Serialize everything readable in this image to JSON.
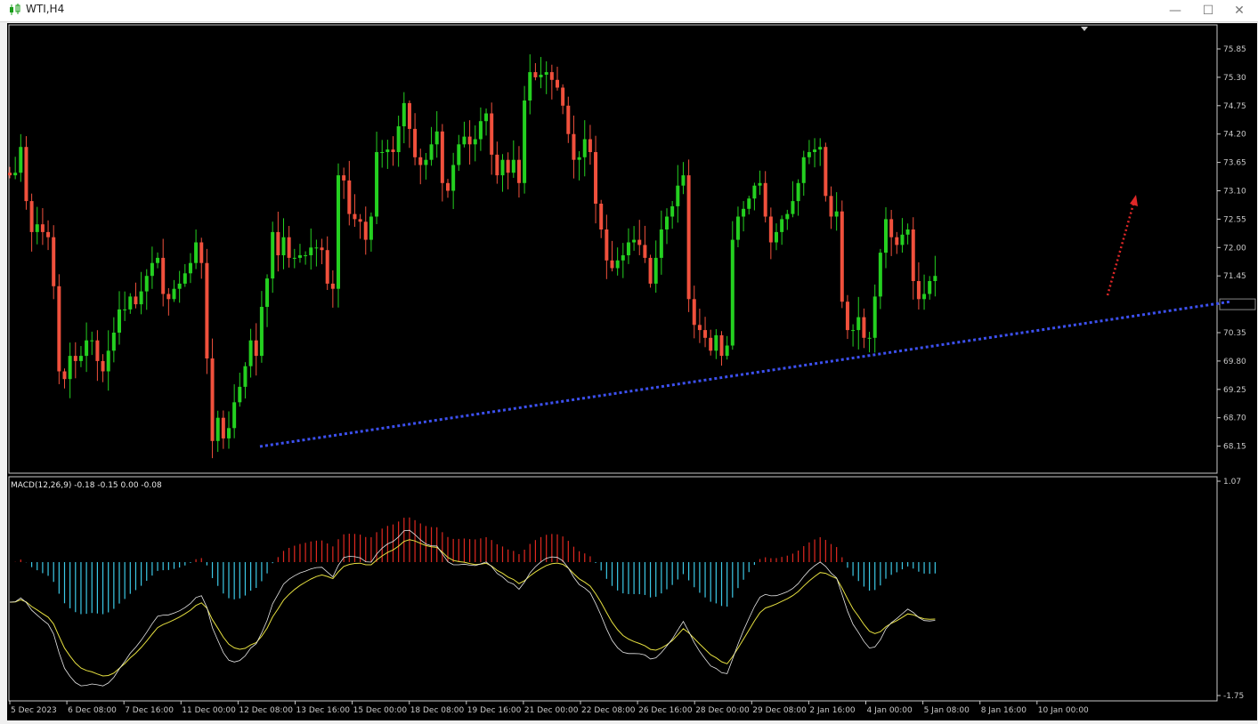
{
  "window": {
    "title": "WTI,H4",
    "minimize_glyph": "—",
    "maximize_glyph": "☐",
    "close_glyph": "✕",
    "icon": "candlestick-chart-icon"
  },
  "colors": {
    "background": "#000000",
    "bull": "#24d020",
    "bear": "#f0503c",
    "axis": "#c8c8c8",
    "trendline": "#3c50f0",
    "arrow": "#e02828",
    "macd_hist_pos": "#e02820",
    "macd_hist_neg": "#3cc8e6",
    "macd_line": "#e6e6e6",
    "signal_line": "#e6e040"
  },
  "price_axis": {
    "labels": [
      "75.85",
      "75.30",
      "74.75",
      "74.20",
      "73.65",
      "73.10",
      "72.55",
      "72.00",
      "71.45",
      "70.90",
      "70.35",
      "69.80",
      "69.25",
      "68.70",
      "68.15"
    ],
    "current_price": "70.90"
  },
  "macd_axis": {
    "labels": [
      "1.07",
      "-1.75"
    ]
  },
  "macd_label": "MACD(12,26,9) -0.18 -0.15 0.00 -0.08",
  "time_axis": {
    "labels": [
      "5 Dec 2023",
      "6 Dec 08:00",
      "7 Dec 16:00",
      "11 Dec 00:00",
      "12 Dec 08:00",
      "13 Dec 16:00",
      "15 Dec 00:00",
      "18 Dec 08:00",
      "19 Dec 16:00",
      "21 Dec 00:00",
      "22 Dec 08:00",
      "26 Dec 16:00",
      "28 Dec 00:00",
      "29 Dec 08:00",
      "2 Jan 16:00",
      "4 Jan 00:00",
      "5 Jan 08:00",
      "8 Jan 16:00",
      "10 Jan 00:00"
    ]
  },
  "chart_data": {
    "type": "candlestick",
    "symbol": "WTI",
    "timeframe": "H4",
    "ylim": [
      67.9,
      76.1
    ],
    "close": [
      73.4,
      73.45,
      73.95,
      72.9,
      72.3,
      72.45,
      72.3,
      72.2,
      71.25,
      69.6,
      69.45,
      69.9,
      69.8,
      69.9,
      70.2,
      70.2,
      69.8,
      69.6,
      70.0,
      70.35,
      70.8,
      70.8,
      71.05,
      70.9,
      71.15,
      71.45,
      71.7,
      71.8,
      71.1,
      71.0,
      71.2,
      71.3,
      71.5,
      71.7,
      72.1,
      71.7,
      69.85,
      68.25,
      68.7,
      68.3,
      68.5,
      69.0,
      69.3,
      69.7,
      70.2,
      69.9,
      70.85,
      71.4,
      72.3,
      71.85,
      72.2,
      71.8,
      71.8,
      71.85,
      71.85,
      72.0,
      72.0,
      71.95,
      71.3,
      71.2,
      73.4,
      73.3,
      72.65,
      72.55,
      72.5,
      72.15,
      72.6,
      73.85,
      73.85,
      73.9,
      73.85,
      74.35,
      74.8,
      74.3,
      73.75,
      73.6,
      73.7,
      74.0,
      74.25,
      73.25,
      73.1,
      73.6,
      74.0,
      74.15,
      74.0,
      74.1,
      74.45,
      74.6,
      73.8,
      73.4,
      73.7,
      73.45,
      73.7,
      73.25,
      74.85,
      75.4,
      75.3,
      75.35,
      75.4,
      75.25,
      75.1,
      74.75,
      74.2,
      73.7,
      73.75,
      74.1,
      73.85,
      72.85,
      72.35,
      71.75,
      71.6,
      71.75,
      71.85,
      72.1,
      72.15,
      72.05,
      71.8,
      71.3,
      71.8,
      72.35,
      72.6,
      72.8,
      73.2,
      73.4,
      71.0,
      70.5,
      70.4,
      70.25,
      70.0,
      70.3,
      69.9,
      70.1,
      72.15,
      72.6,
      72.75,
      72.95,
      73.2,
      73.25,
      72.6,
      72.1,
      72.3,
      72.55,
      72.65,
      72.9,
      73.25,
      73.75,
      73.85,
      73.9,
      73.95,
      73.0,
      72.6,
      72.7,
      70.95,
      70.4,
      70.4,
      70.65,
      70.25,
      70.25,
      71.05,
      71.9,
      72.55,
      72.2,
      72.05,
      72.25,
      72.35,
      71.35,
      71.0,
      71.1,
      71.35,
      71.45
    ]
  },
  "decor": {
    "trendline_label": "",
    "arrow_label": ""
  }
}
